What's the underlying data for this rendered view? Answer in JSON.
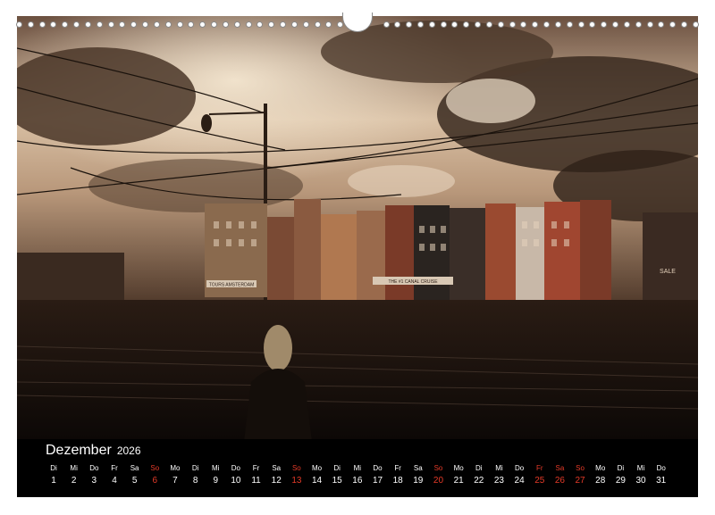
{
  "calendar": {
    "month": "Dezember",
    "year": "2026",
    "days": [
      {
        "wd": "Di",
        "d": "1",
        "red": false
      },
      {
        "wd": "Mi",
        "d": "2",
        "red": false
      },
      {
        "wd": "Do",
        "d": "3",
        "red": false
      },
      {
        "wd": "Fr",
        "d": "4",
        "red": false
      },
      {
        "wd": "Sa",
        "d": "5",
        "red": false
      },
      {
        "wd": "So",
        "d": "6",
        "red": true
      },
      {
        "wd": "Mo",
        "d": "7",
        "red": false
      },
      {
        "wd": "Di",
        "d": "8",
        "red": false
      },
      {
        "wd": "Mi",
        "d": "9",
        "red": false
      },
      {
        "wd": "Do",
        "d": "10",
        "red": false
      },
      {
        "wd": "Fr",
        "d": "11",
        "red": false
      },
      {
        "wd": "Sa",
        "d": "12",
        "red": false
      },
      {
        "wd": "So",
        "d": "13",
        "red": true
      },
      {
        "wd": "Mo",
        "d": "14",
        "red": false
      },
      {
        "wd": "Di",
        "d": "15",
        "red": false
      },
      {
        "wd": "Mi",
        "d": "16",
        "red": false
      },
      {
        "wd": "Do",
        "d": "17",
        "red": false
      },
      {
        "wd": "Fr",
        "d": "18",
        "red": false
      },
      {
        "wd": "Sa",
        "d": "19",
        "red": false
      },
      {
        "wd": "So",
        "d": "20",
        "red": true
      },
      {
        "wd": "Mo",
        "d": "21",
        "red": false
      },
      {
        "wd": "Di",
        "d": "22",
        "red": false
      },
      {
        "wd": "Mi",
        "d": "23",
        "red": false
      },
      {
        "wd": "Do",
        "d": "24",
        "red": false
      },
      {
        "wd": "Fr",
        "d": "25",
        "red": true
      },
      {
        "wd": "Sa",
        "d": "26",
        "red": true
      },
      {
        "wd": "So",
        "d": "27",
        "red": true
      },
      {
        "wd": "Mo",
        "d": "28",
        "red": false
      },
      {
        "wd": "Di",
        "d": "29",
        "red": false
      },
      {
        "wd": "Mi",
        "d": "30",
        "red": false
      },
      {
        "wd": "Do",
        "d": "31",
        "red": false
      }
    ]
  },
  "photo": {
    "signs": {
      "sign_left": "TOURS AMSTERDAM",
      "sign_mid": "THE #1 CANAL CRUISE",
      "sign_right": "SALE"
    }
  },
  "colors": {
    "sepia_sky": "#c9a98a",
    "dark_cloud": "#3a2a20",
    "sunday_red": "#e43a28",
    "calendar_bg": "#000000"
  },
  "icons": {
    "binding": "spiral-binding-hole",
    "hanger": "hanger-notch"
  }
}
